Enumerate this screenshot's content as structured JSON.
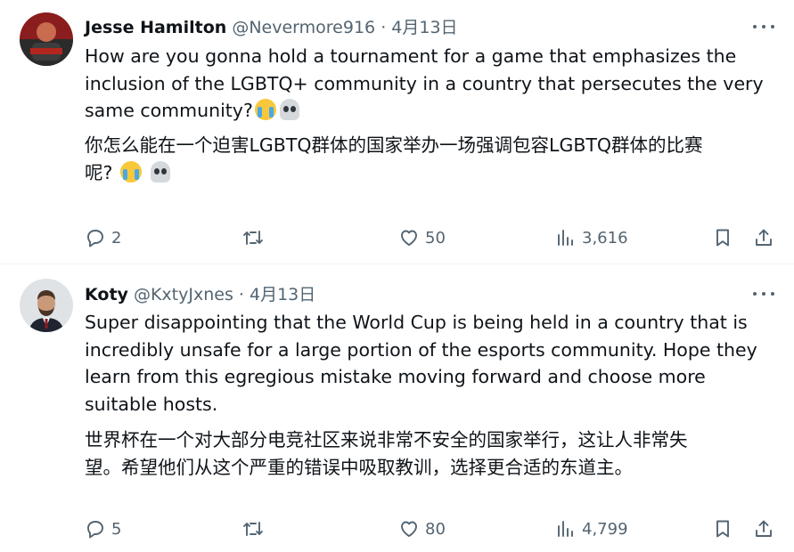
{
  "tweets": [
    {
      "author_name": "Jesse Hamilton",
      "handle": "@Nevermore916",
      "separator": "·",
      "date": "4月13日",
      "text_en_1": "How are you gonna hold a tournament for a game that emphasizes the",
      "text_en_2": "inclusion of the LGBTQ+ community in a country that persecutes the very",
      "text_en_3": "same community?",
      "text_zh_1": "你怎么能在一个迫害LGBTQ群体的国家举办一场强调包容LGBTQ群体的比赛",
      "text_zh_2": "呢? ",
      "replies": "2",
      "likes": "50",
      "views": "3,616",
      "avatar_colors": [
        "#8a1d1d",
        "#2b2b2b"
      ]
    },
    {
      "author_name": "Koty",
      "handle": "@KxtyJxnes",
      "separator": "·",
      "date": "4月13日",
      "text_en_1": "Super disappointing that the World Cup is being held in a country that is",
      "text_en_2": "incredibly unsafe for a large portion of the esports community. Hope they",
      "text_en_3": "learn from this egregious mistake moving forward and choose more",
      "text_en_4": "suitable hosts.",
      "text_zh_1": "世界杯在一个对大部分电竞社区来说非常不安全的国家举行，这让人非常失",
      "text_zh_2": "望。希望他们从这个严重的错误中吸取教训，选择更合适的东道主。",
      "replies": "5",
      "likes": "80",
      "views": "4,799",
      "avatar_colors": [
        "#dfe3e6",
        "#4a3426"
      ]
    }
  ],
  "icons": {
    "reply": "reply-icon",
    "retweet": "retweet-icon",
    "like": "like-icon",
    "views": "views-icon",
    "bookmark": "bookmark-icon",
    "share": "share-icon",
    "more": "more-icon"
  },
  "colors": {
    "text_primary": "#0f1419",
    "text_secondary": "#536471",
    "divider": "#eff3f4"
  }
}
